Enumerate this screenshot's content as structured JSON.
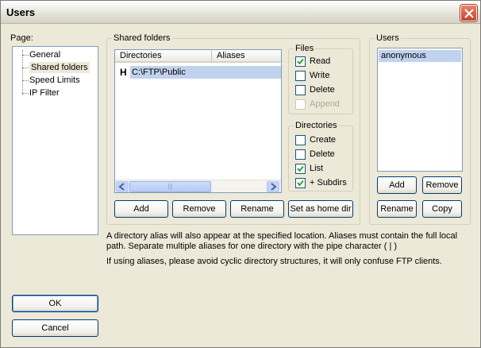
{
  "window": {
    "title": "Users"
  },
  "page_panel": {
    "label": "Page:",
    "items": [
      "General",
      "Shared folders",
      "Speed Limits",
      "IP Filter"
    ],
    "selected": "Shared folders"
  },
  "shared_folders": {
    "label": "Shared folders",
    "columns": [
      "Directories",
      "Aliases"
    ],
    "rows": [
      {
        "flag": "H",
        "directory": "C:\\FTP\\Public",
        "aliases": ""
      }
    ],
    "scrollbar_grip": "|||",
    "buttons": {
      "add": "Add",
      "remove": "Remove",
      "rename": "Rename",
      "set_home": "Set as home dir"
    }
  },
  "files": {
    "label": "Files",
    "options": [
      {
        "label": "Read",
        "checked": true,
        "enabled": true
      },
      {
        "label": "Write",
        "checked": false,
        "enabled": true
      },
      {
        "label": "Delete",
        "checked": false,
        "enabled": true
      },
      {
        "label": "Append",
        "checked": false,
        "enabled": false
      }
    ]
  },
  "directories": {
    "label": "Directories",
    "options": [
      {
        "label": "Create",
        "checked": false,
        "enabled": true
      },
      {
        "label": "Delete",
        "checked": false,
        "enabled": true
      },
      {
        "label": "List",
        "checked": true,
        "enabled": true
      },
      {
        "label": "+ Subdirs",
        "checked": true,
        "enabled": true
      }
    ]
  },
  "users": {
    "label": "Users",
    "list": [
      "anonymous"
    ],
    "selected": "anonymous",
    "buttons": {
      "add": "Add",
      "remove": "Remove",
      "rename": "Rename",
      "copy": "Copy"
    }
  },
  "info": {
    "line1": "A directory alias will also appear at the specified location. Aliases must contain the full local",
    "line2": "path. Separate multiple aliases for one directory with the pipe character ( | )",
    "line3": "If using aliases, please avoid cyclic directory structures, it will only confuse FTP clients."
  },
  "dialog_buttons": {
    "ok": "OK",
    "cancel": "Cancel"
  },
  "colors": {
    "selection": "#c1d2ee",
    "accent": "#003c74",
    "close": "#c4452a"
  }
}
